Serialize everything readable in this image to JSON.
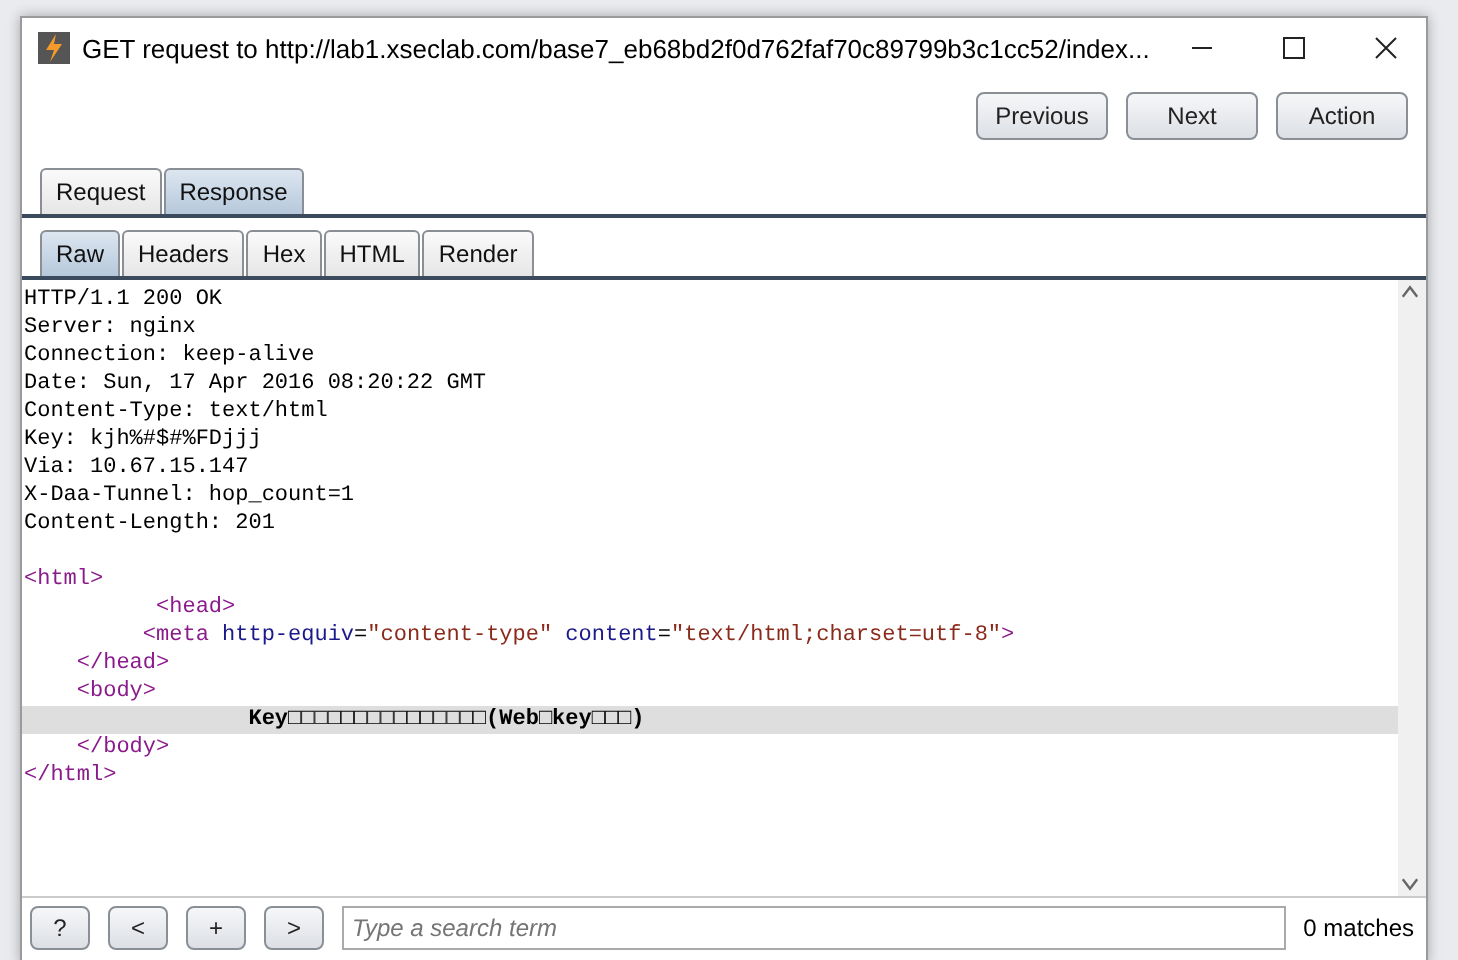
{
  "window": {
    "title": "GET request to http://lab1.xseclab.com/base7_eb68bd2f0d762faf70c89799b3c1cc52/index..."
  },
  "nav_buttons": [
    "Previous",
    "Next",
    "Action"
  ],
  "tabs": [
    {
      "label": "Request",
      "selected": false
    },
    {
      "label": "Response",
      "selected": true
    }
  ],
  "subtabs": [
    {
      "label": "Raw",
      "selected": true
    },
    {
      "label": "Headers",
      "selected": false
    },
    {
      "label": "Hex",
      "selected": false
    },
    {
      "label": "HTML",
      "selected": false
    },
    {
      "label": "Render",
      "selected": false
    }
  ],
  "header_lines": [
    {
      "highlighted": false,
      "segments": [
        {
          "kind": "text",
          "text": "HTTP/1.1 200 OK"
        }
      ]
    },
    {
      "highlighted": false,
      "segments": [
        {
          "kind": "text",
          "text": "Server: nginx"
        }
      ]
    },
    {
      "highlighted": false,
      "segments": [
        {
          "kind": "text",
          "text": "Connection: keep-alive"
        }
      ]
    },
    {
      "highlighted": false,
      "segments": [
        {
          "kind": "text",
          "text": "Date: Sun, 17 Apr 2016 08:20:22 GMT"
        }
      ]
    },
    {
      "highlighted": false,
      "segments": [
        {
          "kind": "text",
          "text": "Content-Type: text/html"
        }
      ]
    },
    {
      "highlighted": false,
      "segments": [
        {
          "kind": "text",
          "text": "Key: kjh%#$#%FDjjj"
        }
      ]
    },
    {
      "highlighted": false,
      "segments": [
        {
          "kind": "text",
          "text": "Via: 10.67.15.147"
        }
      ]
    },
    {
      "highlighted": false,
      "segments": [
        {
          "kind": "text",
          "text": "X-Daa-Tunnel: hop_count=1"
        }
      ]
    },
    {
      "highlighted": false,
      "segments": [
        {
          "kind": "text",
          "text": "Content-Length: 201"
        }
      ]
    }
  ],
  "body_lines": [
    {
      "highlighted": false,
      "segments": [
        {
          "kind": "tag",
          "text": "<html>"
        }
      ]
    },
    {
      "highlighted": false,
      "segments": [
        {
          "kind": "tag",
          "text": "          <head>"
        }
      ]
    },
    {
      "highlighted": false,
      "segments": [
        {
          "kind": "tag",
          "text": "         <meta"
        },
        {
          "kind": "attr",
          "text": " http-equiv"
        },
        {
          "kind": "text",
          "text": "="
        },
        {
          "kind": "value",
          "text": "\"content-type\""
        },
        {
          "kind": "attr",
          "text": " content"
        },
        {
          "kind": "text",
          "text": "="
        },
        {
          "kind": "value",
          "text": "\"text/html;charset=utf-8\""
        },
        {
          "kind": "tag",
          "text": ">"
        }
      ]
    },
    {
      "highlighted": false,
      "segments": [
        {
          "kind": "tag",
          "text": "    </head>"
        }
      ]
    },
    {
      "highlighted": false,
      "segments": [
        {
          "kind": "tag",
          "text": "    <body>"
        }
      ]
    },
    {
      "highlighted": true,
      "segments": [
        {
          "kind": "bold",
          "text": "                 Key□□□□□□□□□□□□□□□(Web□key□□□)"
        }
      ]
    },
    {
      "highlighted": false,
      "segments": [
        {
          "kind": "tag",
          "text": "    </body>"
        }
      ]
    },
    {
      "highlighted": false,
      "segments": [
        {
          "kind": "tag",
          "text": "</html>"
        }
      ]
    }
  ],
  "search": {
    "buttons": [
      "?",
      "<",
      "+",
      ">"
    ],
    "placeholder": "Type a search term",
    "matches": "0 matches"
  }
}
